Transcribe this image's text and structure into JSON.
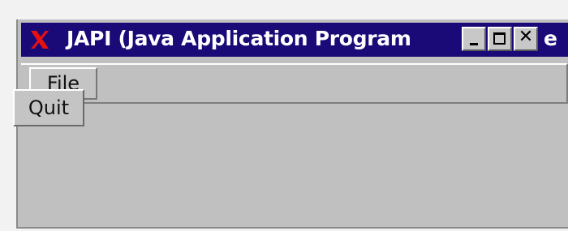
{
  "window": {
    "title": "JAPI (Java Application Program",
    "title_overflow": "e"
  },
  "window_buttons": {
    "minimize_icon": "minimize-icon",
    "maximize_icon": "maximize-icon",
    "close_glyph": "✕"
  },
  "menubar": {
    "items": [
      {
        "label": "File"
      }
    ]
  },
  "file_menu": {
    "items": [
      {
        "label": "Quit"
      }
    ]
  },
  "colors": {
    "titlebar": "#1a0a78",
    "window_bg": "#c0c0c0",
    "x_logo": "#e81010",
    "title_text": "#ffffff"
  }
}
